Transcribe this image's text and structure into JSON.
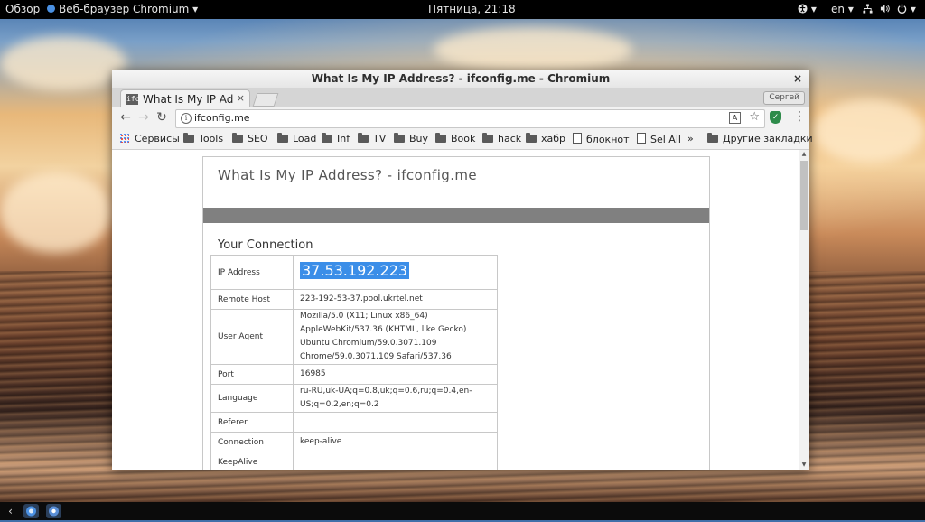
{
  "topbar": {
    "activities": "Обзор",
    "app_menu": "Веб-браузер Chromium",
    "clock": "Пятница, 21:18",
    "language": "en",
    "icons": [
      "accessibility-icon",
      "network-icon",
      "volume-icon",
      "power-icon"
    ]
  },
  "window": {
    "title": "What Is My IP Address? - ifconfig.me - Chromium",
    "close_glyph": "×"
  },
  "tabs": {
    "active": {
      "favicon": "ifc",
      "title": "What Is My IP Address? - ifconfig.me",
      "close_glyph": "×"
    },
    "profile_button": "Сергей"
  },
  "toolbar": {
    "back": "←",
    "forward": "→",
    "reload": "↻",
    "url": "ifconfig.me",
    "star": "☆",
    "menu": "⋮"
  },
  "bookmarks": {
    "apps": "Сервисы",
    "items": [
      "Tools",
      "SEO",
      "Load",
      "Inf",
      "TV",
      "Buy",
      "Book",
      "hack",
      "хабр",
      "блокнот",
      "Sel All"
    ],
    "overflow": "»",
    "other": "Другие закладки"
  },
  "page": {
    "title": "What Is My IP Address? - ifconfig.me",
    "section": "Your Connection",
    "rows": [
      {
        "key": "IP Address",
        "value": "37.53.192.223"
      },
      {
        "key": "Remote Host",
        "value": "223-192-53-37.pool.ukrtel.net"
      },
      {
        "key": "User Agent",
        "value": "Mozilla/5.0 (X11; Linux x86_64) AppleWebKit/537.36 (KHTML, like Gecko) Ubuntu Chromium/59.0.3071.109 Chrome/59.0.3071.109 Safari/537.36"
      },
      {
        "key": "Port",
        "value": "16985"
      },
      {
        "key": "Language",
        "value": "ru-RU,uk-UA;q=0.8,uk;q=0.6,ru;q=0.4,en-US;q=0.2,en;q=0.2"
      },
      {
        "key": "Referer",
        "value": ""
      },
      {
        "key": "Connection",
        "value": "keep-alive"
      },
      {
        "key": "KeepAlive",
        "value": ""
      }
    ]
  },
  "colors": {
    "selection": "#3b8ee8",
    "band": "#808080",
    "topbar": "#000000"
  }
}
